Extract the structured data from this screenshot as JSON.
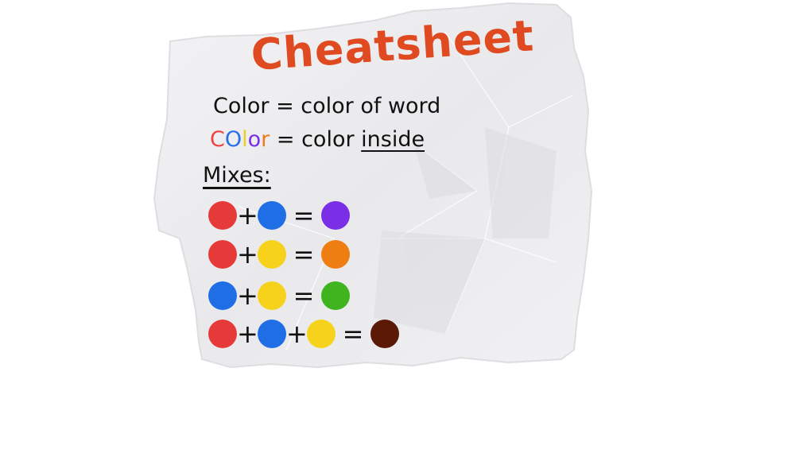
{
  "cheatsheet": {
    "title": "Cheatsheet",
    "rule_color_of_word": "Color = color of word",
    "rule_color_inside": {
      "colored_letters": [
        "C",
        "O",
        "l",
        "o",
        "r"
      ],
      "suffix": "= color",
      "emphasized": "inside"
    },
    "mixes_label": "Mixes:",
    "plus_symbol": "+",
    "equals_symbol": "=",
    "mixes": [
      {
        "inputs": [
          "red",
          "blue"
        ],
        "result": "purple"
      },
      {
        "inputs": [
          "red",
          "yellow"
        ],
        "result": "orange"
      },
      {
        "inputs": [
          "blue",
          "yellow"
        ],
        "result": "green"
      },
      {
        "inputs": [
          "red",
          "blue",
          "yellow"
        ],
        "result": "brown"
      }
    ]
  },
  "colors": {
    "title": "#e04a21",
    "ink": "#111111",
    "paper": "#efeff1",
    "red": "#e63a3a",
    "blue": "#1f6ee6",
    "yellow": "#f6d21c",
    "purple": "#7a2ee6",
    "orange": "#ef7e12",
    "green": "#3fb41f",
    "brown": "#5a1a06",
    "color_word_letters": [
      "#ee4444",
      "#2a6ee8",
      "#e8d020",
      "#7a2ee6",
      "#ee7a1a"
    ]
  }
}
